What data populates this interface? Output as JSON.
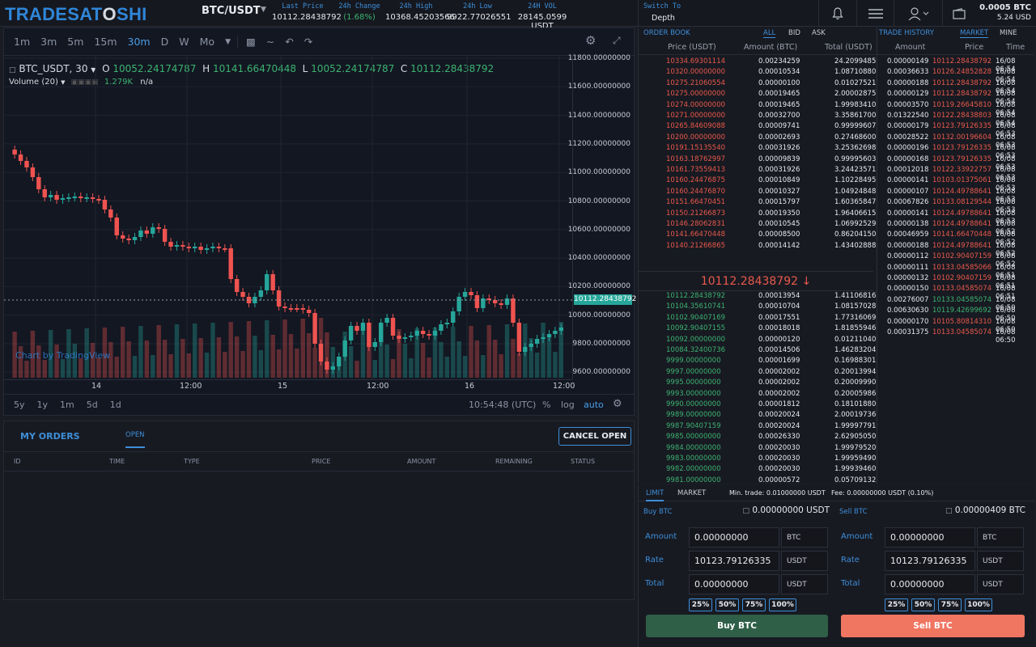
{
  "header": {
    "logo_a": "TRADESAT",
    "logo_b": "O",
    "logo_c": "SHI",
    "pair": "BTC/USDT",
    "stats": [
      {
        "label": "Last Price",
        "value": "10112.28438792"
      },
      {
        "label": "24h Change",
        "value": "(1.68%)"
      },
      {
        "label": "24h High",
        "value": "10368.45203566"
      },
      {
        "label": "24h Low",
        "value": "9922.77026551"
      },
      {
        "label": "24H VOL",
        "value": "28145.0599 USDT"
      }
    ],
    "switch_label": "Switch To",
    "switch_value": "Depth",
    "balance_btc": "0.0005 BTC",
    "balance_usd": "5.24 USD"
  },
  "chart": {
    "intervals": [
      "1m",
      "3m",
      "5m",
      "15m",
      "30m",
      "D",
      "W",
      "Mo"
    ],
    "active_interval": "30m",
    "symbol": "BTC_USDT, 30",
    "open_lbl": "O",
    "open": "10052.24174787",
    "high_lbl": "H",
    "high": "10141.66470448",
    "low_lbl": "L",
    "low": "10052.24174787",
    "close_lbl": "C",
    "close": "10112.28438792",
    "volume_label": "Volume (20)",
    "volume_value": "1.279K",
    "volume_na": "n/a",
    "price_ticks": [
      "11800.00000000",
      "11600.00000000",
      "11400.00000000",
      "11200.00000000",
      "11000.00000000",
      "10800.00000000",
      "10600.00000000",
      "10400.00000000",
      "10200.00000000",
      "10000.00000000",
      "9800.00000000",
      "9600.00000000"
    ],
    "current_price_tag": "10112.28438792",
    "time_ticks": [
      "14",
      "12:00",
      "15",
      "12:00",
      "16",
      "12:00"
    ],
    "ranges": [
      "5y",
      "1y",
      "1m",
      "5d",
      "1d"
    ],
    "clock": "10:54:48 (UTC)",
    "pct": "%",
    "log": "log",
    "auto": "auto",
    "watermark": "Chart by TradingView"
  },
  "orders": {
    "title": "MY ORDERS",
    "tab_open": "OPEN",
    "cancel_label": "CANCEL OPEN",
    "columns": [
      "ID",
      "TIME",
      "TYPE",
      "PRICE",
      "AMOUNT",
      "REMAINING",
      "STATUS"
    ]
  },
  "orderbook": {
    "title": "ORDER BOOK",
    "filters": [
      "ALL",
      "BID",
      "ASK"
    ],
    "col_price": "Price (USDT)",
    "col_amount": "Amount (BTC)",
    "col_total": "Total (USDT)",
    "asks": [
      [
        "10334.69301114",
        "0.00234259",
        "24.20994850"
      ],
      [
        "10320.00000000",
        "0.00010534",
        "1.08710880"
      ],
      [
        "10275.21060554",
        "0.00000100",
        "0.01027521"
      ],
      [
        "10275.00000000",
        "0.00019465",
        "2.00002875"
      ],
      [
        "10274.00000000",
        "0.00019465",
        "1.99983410"
      ],
      [
        "10271.00000000",
        "0.00032700",
        "3.35861700"
      ],
      [
        "10265.84609088",
        "0.00009741",
        "0.99999607"
      ],
      [
        "10200.00000000",
        "0.00002693",
        "0.27468600"
      ],
      [
        "10191.15135540",
        "0.00031926",
        "3.25362698"
      ],
      [
        "10163.18762997",
        "0.00009839",
        "0.99995603"
      ],
      [
        "10161.73559413",
        "0.00031926",
        "3.24423571"
      ],
      [
        "10160.24476875",
        "0.00010849",
        "1.10228495"
      ],
      [
        "10160.24476870",
        "0.00010327",
        "1.04924848"
      ],
      [
        "10151.66470451",
        "0.00015797",
        "1.60365847"
      ],
      [
        "10150.21266873",
        "0.00019350",
        "1.96406615"
      ],
      [
        "10146.28062831",
        "0.00010545",
        "1.06992529"
      ],
      [
        "10141.66470448",
        "0.00008500",
        "0.86204150"
      ],
      [
        "10140.21266865",
        "0.00014142",
        "1.43402888"
      ]
    ],
    "mid_price": "10112.28438792 ↓",
    "bids": [
      [
        "10112.28438792",
        "0.00013954",
        "1.41106816"
      ],
      [
        "10104.35610741",
        "0.00010704",
        "1.08157028"
      ],
      [
        "10102.90407169",
        "0.00017551",
        "1.77316069"
      ],
      [
        "10092.90407155",
        "0.00018018",
        "1.81855946"
      ],
      [
        "10092.00000000",
        "0.00000120",
        "0.01211040"
      ],
      [
        "10084.32400736",
        "0.00014506",
        "1.46283204"
      ],
      [
        "9999.00000000",
        "0.00001699",
        "0.16988301"
      ],
      [
        "9997.00000000",
        "0.00002002",
        "0.20013994"
      ],
      [
        "9995.00000000",
        "0.00002002",
        "0.20009990"
      ],
      [
        "9993.00000000",
        "0.00002002",
        "0.20005986"
      ],
      [
        "9990.00000000",
        "0.00001812",
        "0.18101880"
      ],
      [
        "9989.00000000",
        "0.00020024",
        "2.00019736"
      ],
      [
        "9987.90407159",
        "0.00020024",
        "1.99997791"
      ],
      [
        "9985.00000000",
        "0.00026330",
        "2.62905050"
      ],
      [
        "9984.00000000",
        "0.00020030",
        "1.99979520"
      ],
      [
        "9983.00000000",
        "0.00020030",
        "1.99959490"
      ],
      [
        "9982.00000000",
        "0.00020030",
        "1.99939460"
      ],
      [
        "9981.00000000",
        "0.00000572",
        "0.05709132"
      ]
    ]
  },
  "history": {
    "title": "TRADE HISTORY",
    "tab_market": "MARKET",
    "tab_mine": "MINE",
    "col_amount": "Amount",
    "col_price": "Price",
    "col_time": "Time",
    "rows": [
      [
        "0.00000149",
        "10112.28438792",
        "16/08 06:54",
        "sell"
      ],
      [
        "0.00036633",
        "10126.24852828",
        "16/08 06:54",
        "sell"
      ],
      [
        "0.00000188",
        "10112.28438792",
        "16/08 06:54",
        "sell"
      ],
      [
        "0.00000129",
        "10112.28438792",
        "16/08 06:54",
        "sell"
      ],
      [
        "0.00003570",
        "10119.26645810",
        "16/08 06:54",
        "sell"
      ],
      [
        "0.01322540",
        "10122.28438803",
        "16/08 06:54",
        "sell"
      ],
      [
        "0.00000179",
        "10123.79126335",
        "16/08 06:53",
        "sell"
      ],
      [
        "0.00028522",
        "10132.00196604",
        "16/08 06:53",
        "sell"
      ],
      [
        "0.00000196",
        "10123.79126335",
        "16/08 06:53",
        "sell"
      ],
      [
        "0.00000168",
        "10123.79126335",
        "16/08 06:53",
        "sell"
      ],
      [
        "0.00012018",
        "10122.33922757",
        "16/08 06:53",
        "sell"
      ],
      [
        "0.00000141",
        "10103.01375061",
        "16/08 06:53",
        "sell"
      ],
      [
        "0.00000107",
        "10124.49788641",
        "16/08 06:53",
        "sell"
      ],
      [
        "0.00067826",
        "10133.08129544",
        "16/08 06:53",
        "sell"
      ],
      [
        "0.00000141",
        "10124.49788641",
        "16/08 06:53",
        "sell"
      ],
      [
        "0.00000138",
        "10124.49788641",
        "16/08 06:52",
        "sell"
      ],
      [
        "0.00046959",
        "10141.66470448",
        "16/08 06:52",
        "sell"
      ],
      [
        "0.00000188",
        "10124.49788641",
        "16/08 06:52",
        "sell"
      ],
      [
        "0.00000112",
        "10102.90407159",
        "16/08 06:52",
        "sell"
      ],
      [
        "0.00000111",
        "10133.04585066",
        "16/08 06:51",
        "sell"
      ],
      [
        "0.00000132",
        "10102.90407159",
        "16/08 06:51",
        "sell"
      ],
      [
        "0.00000150",
        "10133.04585074",
        "16/08 06:51",
        "sell"
      ],
      [
        "0.00276007",
        "10133.04585074",
        "16/08 06:50",
        "buy"
      ],
      [
        "0.00630630",
        "10119.42699692",
        "16/08 06:50",
        "buy"
      ],
      [
        "0.00000170",
        "10105.80814310",
        "16/08 06:50",
        "sell"
      ],
      [
        "0.00031375",
        "10133.04585074",
        "16/08 06:50",
        "sell"
      ]
    ]
  },
  "trade": {
    "tab_limit": "LIMIT",
    "tab_market": "MARKET",
    "min_trade": "Min. trade: 0.01000000 USDT",
    "fee": "Fee: 0.00000000 USDT (0.10%)",
    "buy": {
      "title": "Buy BTC",
      "balance": "0.00000000 USDT",
      "amount_lbl": "Amount",
      "amount": "0.00000000",
      "amount_cur": "BTC",
      "rate_lbl": "Rate",
      "rate": "10123.79126335",
      "rate_cur": "USDT",
      "total_lbl": "Total",
      "total": "0.00000000",
      "total_cur": "USDT",
      "pcts": [
        "25%",
        "50%",
        "75%",
        "100%"
      ],
      "button": "Buy BTC"
    },
    "sell": {
      "title": "Sell BTC",
      "balance": "0.00000409 BTC",
      "amount_lbl": "Amount",
      "amount": "0.00000000",
      "amount_cur": "BTC",
      "rate_lbl": "Rate",
      "rate": "10123.79126335",
      "rate_cur": "USDT",
      "total_lbl": "Total",
      "total": "0.00000000",
      "total_cur": "USDT",
      "pcts": [
        "25%",
        "50%",
        "75%",
        "100%"
      ],
      "button": "Sell BTC"
    }
  },
  "colors": {
    "ask": "#e8594a",
    "bid": "#3cb371",
    "accent": "#3d8fd9"
  }
}
